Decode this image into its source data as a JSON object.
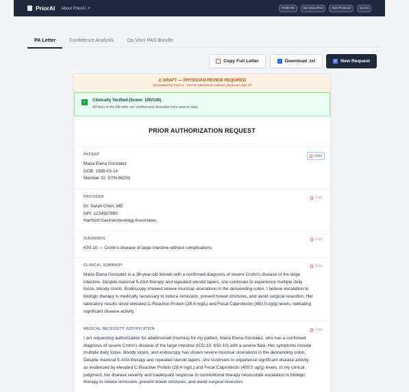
{
  "header": {
    "brand": "PriorAI",
    "about_link": "About PriorAI ↗",
    "badges": [
      "FHIR R4",
      "Da Vinci PAS",
      "A2A Protocol",
      "v1.0.0"
    ]
  },
  "tabs": [
    {
      "label": "PA Letter",
      "active": true
    },
    {
      "label": "Confidence Analysis",
      "active": false
    },
    {
      "label": "Da Vinci PAS Bundle",
      "active": false
    }
  ],
  "actions": {
    "copy_full": "Copy Full Letter",
    "download": "Download .txt",
    "new_request": "New Request"
  },
  "banner": {
    "title": "⚠ DRAFT — PHYSICIAN REVIEW REQUIRED",
    "subtitle": "Generated by PriorAI · Not for submission without physician sign-off"
  },
  "verification": {
    "title": "Clinically Verified (Score: 100/100)",
    "subtitle": "All facts in the PA letter are verified and derivable from source data."
  },
  "letter": {
    "title": "PRIOR AUTHORIZATION REQUEST",
    "copy_label": "Copy",
    "patient": {
      "label": "PATIENT",
      "lines": [
        "Maria Elena Gonzalez",
        "DOB: 1985-03-14",
        "Member ID: SYN-88291"
      ]
    },
    "provider": {
      "label": "PROVIDER",
      "lines": [
        "Dr. Sarah Chen, MD",
        "NPI: 1234567890",
        "Hartford Gastroenterology Associates"
      ]
    },
    "diagnosis": {
      "label": "DIAGNOSIS",
      "lines": [
        "K50.10 — Crohn's disease of large intestine without complications"
      ]
    },
    "clinical_summary": {
      "label": "CLINICAL SUMMARY",
      "lines": [
        "Maria Elena Gonzalez is a 38-year-old female with a confirmed diagnosis of severe Crohn's disease of the large",
        "intestine. Despite maximal 5-ASA therapy and repeated steroid tapers, she continues to experience multiple daily",
        "loose, bloody stools. Endoscopy showed severe mucosal ulcerations in the descending colon. I believe escalation to",
        "biologic therapy is medically necessary to induce remission, prevent bowel strictures, and avoid surgical resection. Her",
        "laboratory results show elevated C-Reactive Protein (28.4 mg/L) and Fecal Calprotectin (450.0 ug/g) levels, indicating",
        "significant disease activity."
      ]
    },
    "medical_necessity": {
      "label": "MEDICAL NECESSITY JUSTIFICATION",
      "lines": [
        "I am requesting authorization for adalimumab (Humira) for my patient, Maria Elena Gonzalez, who has a confirmed",
        "diagnosis of severe Crohn's disease of the large intestine (ICD-10: K50.10) with a severe flare. Her symptoms include",
        "multiple daily loose, bloody stools, and endoscopy has shown severe mucosal ulcerations in the descending colon.",
        "Despite maximal 5-ASA therapy and repeated steroid tapers, she continues to experience significant disease activity,",
        "as evidenced by elevated C-Reactive Protein (28.4 mg/L) and Fecal Calprotectin (450.0 ug/g) levels. In my clinical",
        "judgment, her disease severity and inadequate response to conventional therapy necessitate escalation to biologic",
        "therapy to induce remission, prevent bowel strictures, and avoid surgical resection."
      ]
    }
  }
}
